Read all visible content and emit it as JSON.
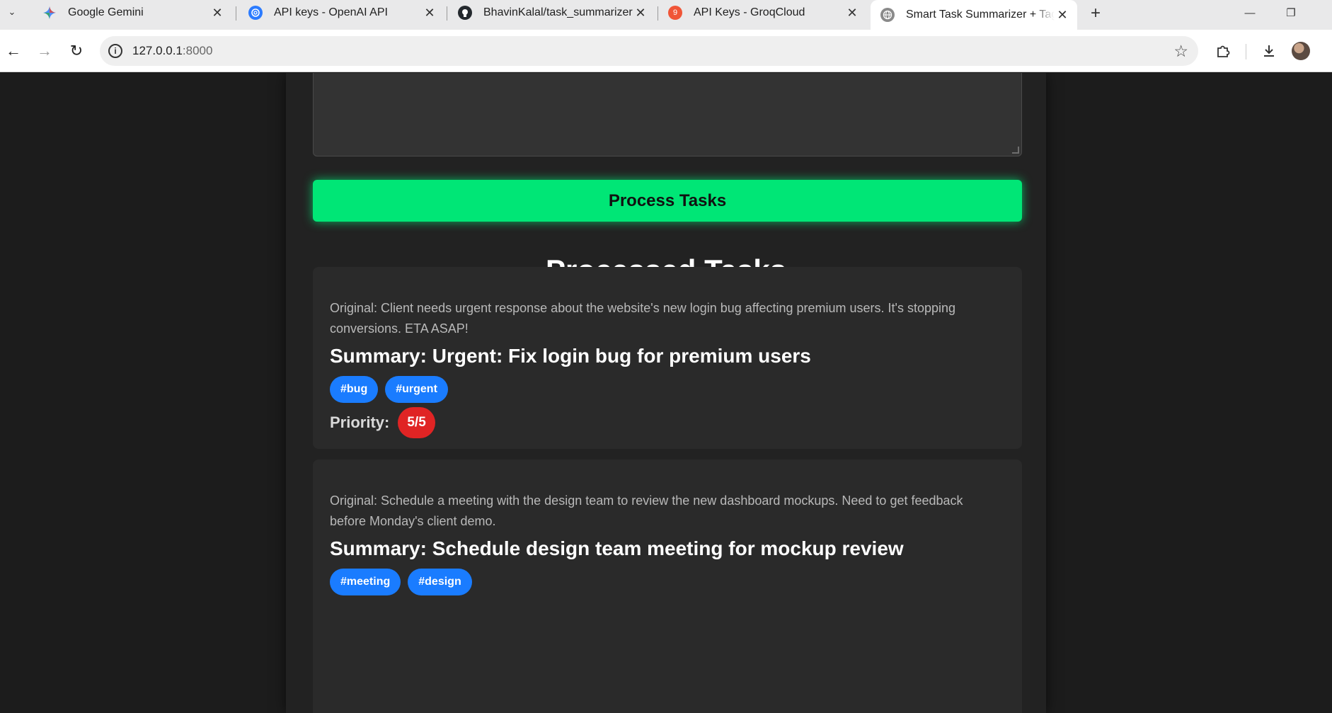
{
  "browser": {
    "tabs": [
      {
        "title": "Google Gemini",
        "icon": "gemini-icon"
      },
      {
        "title": "API keys - OpenAI API",
        "icon": "openai-icon"
      },
      {
        "title": "BhavinKalal/task_summarizer",
        "icon": "github-icon"
      },
      {
        "title": "API Keys - GroqCloud",
        "icon": "groq-icon",
        "badge": "9"
      },
      {
        "title": "Smart Task Summarizer + Tagger",
        "icon": "globe-icon",
        "active": true
      }
    ],
    "url_host": "127.0.0.1",
    "url_port": ":8000"
  },
  "page": {
    "process_button_label": "Process Tasks",
    "section_title": "Processed Tasks",
    "tasks": [
      {
        "original": "Original: Client needs urgent response about the website's new login bug affecting premium users. It's stopping conversions. ETA ASAP!",
        "summary": "Summary: Urgent: Fix login bug for premium users",
        "tags": [
          "#bug",
          "#urgent"
        ],
        "priority_label": "Priority:",
        "priority": "5/5"
      },
      {
        "original": "Original: Schedule a meeting with the design team to review the new dashboard mockups. Need to get feedback before Monday's client demo.",
        "summary": "Summary: Schedule design team meeting for mockup review",
        "tags": [
          "#meeting",
          "#design"
        ]
      }
    ]
  },
  "colors": {
    "accent_green": "#00e676",
    "tag_blue": "#1a7cff",
    "priority_red": "#e02424",
    "page_background": "#1c1c1c",
    "card_background": "#2a2a2a"
  }
}
